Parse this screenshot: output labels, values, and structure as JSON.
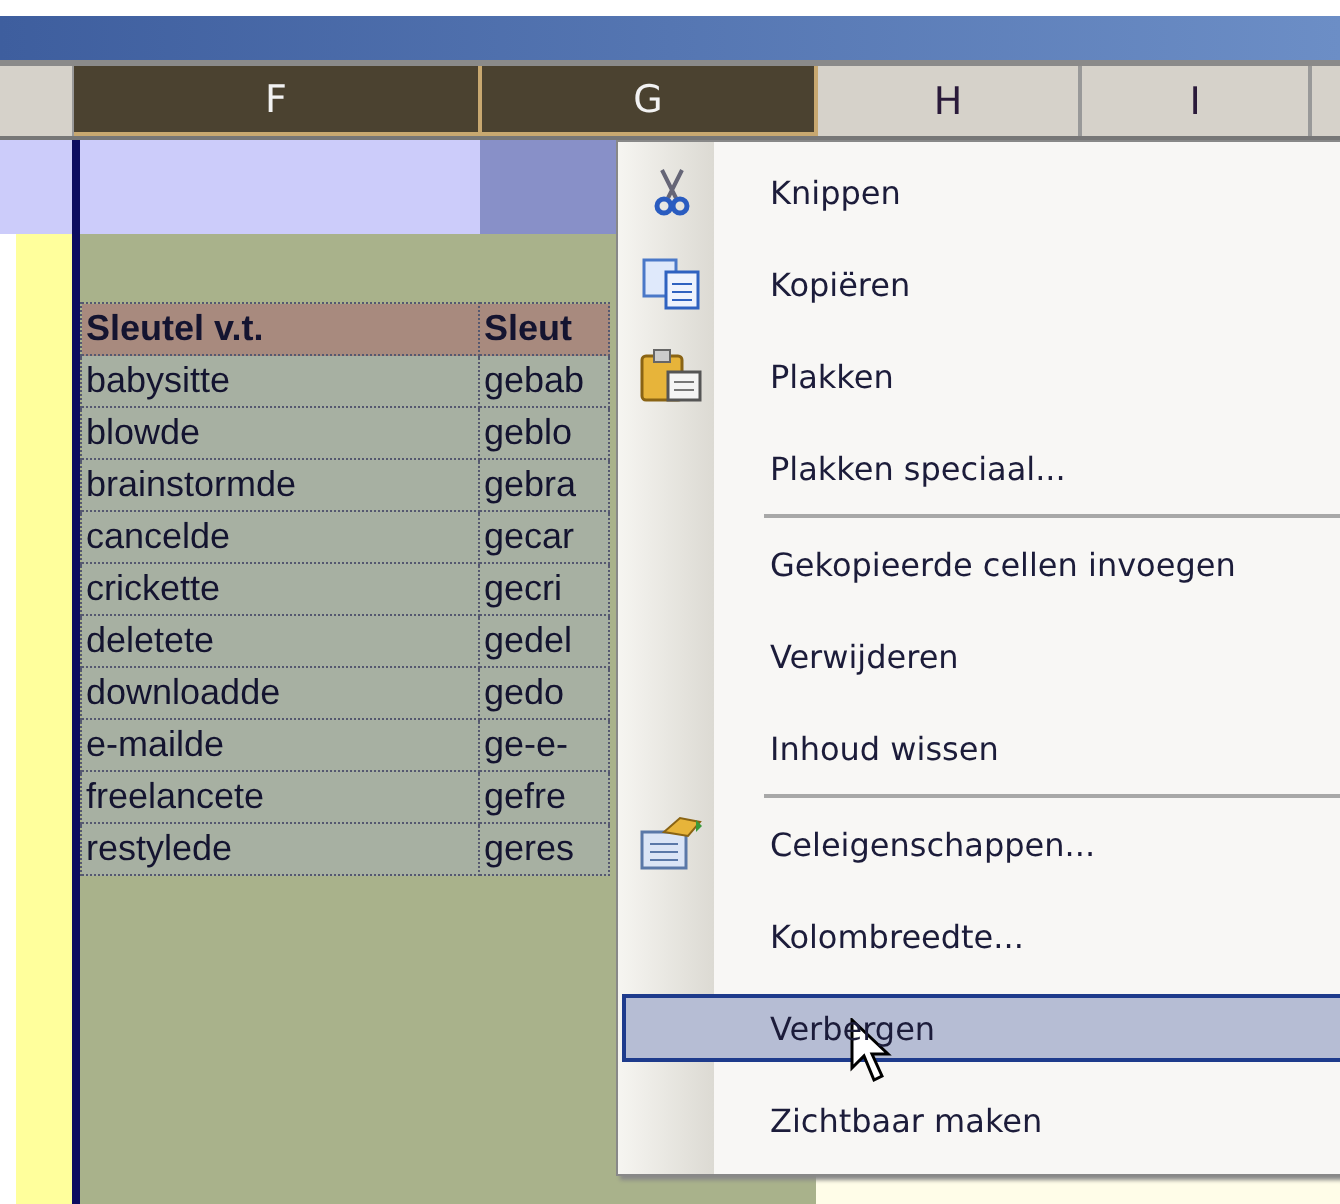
{
  "column_headers": [
    {
      "label": "F",
      "selected": true
    },
    {
      "label": "G",
      "selected": true
    },
    {
      "label": "H",
      "selected": false
    },
    {
      "label": "I",
      "selected": false
    }
  ],
  "table": {
    "columns": [
      "Sleutel v.t.",
      "Sleut"
    ],
    "rows": [
      [
        "babysitte",
        "gebab"
      ],
      [
        "blowde",
        "geblo"
      ],
      [
        "brainstormde",
        "gebra"
      ],
      [
        "cancelde",
        "gecar"
      ],
      [
        "crickette",
        "gecri"
      ],
      [
        "deletete",
        "gedel"
      ],
      [
        "downloadde",
        "gedo"
      ],
      [
        "e-mailde",
        "ge-e-"
      ],
      [
        "freelancete",
        "gefre"
      ],
      [
        "restylede",
        "geres"
      ]
    ]
  },
  "context_menu": {
    "items": [
      {
        "kind": "cut",
        "label": "Knippen",
        "selected": false
      },
      {
        "kind": "copy",
        "label": "Kopiëren",
        "selected": false
      },
      {
        "kind": "paste",
        "label": "Plakken",
        "selected": false
      },
      {
        "kind": "plain",
        "label": "Plakken speciaal...",
        "selected": false
      },
      {
        "kind": "separator"
      },
      {
        "kind": "plain",
        "label": "Gekopieerde cellen invoegen",
        "selected": false
      },
      {
        "kind": "plain",
        "label": "Verwijderen",
        "selected": false
      },
      {
        "kind": "plain",
        "label": "Inhoud wissen",
        "selected": false
      },
      {
        "kind": "separator"
      },
      {
        "kind": "properties",
        "label": "Celeigenschappen...",
        "selected": false
      },
      {
        "kind": "plain",
        "label": "Kolombreedte...",
        "selected": false
      },
      {
        "kind": "plain",
        "label": "Verbergen",
        "selected": true
      },
      {
        "kind": "plain",
        "label": "Zichtbaar maken",
        "selected": false
      }
    ]
  }
}
